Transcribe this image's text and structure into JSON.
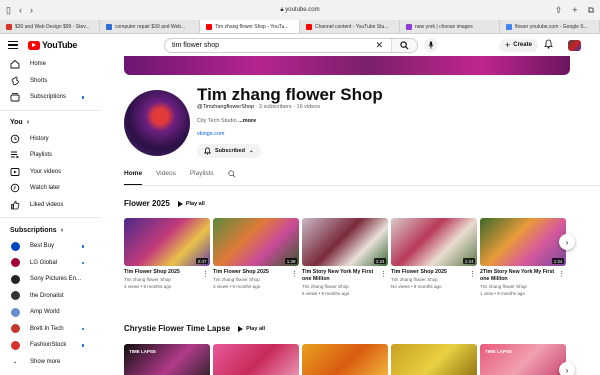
{
  "browser": {
    "url": "youtube.com",
    "tabs": [
      {
        "label": "$30 and Web Design $99 - Stev...",
        "color": "#d8342c"
      },
      {
        "label": "computer repair $30 and Web...",
        "color": "#2d6fd6"
      },
      {
        "label": "Tim zhang flower Shop - YouTu...",
        "color": "#ff0000",
        "active": true
      },
      {
        "label": "Channel content - YouTube Stu...",
        "color": "#ff0000"
      },
      {
        "label": "new york | choose images",
        "color": "#8a3fd6"
      },
      {
        "label": "flower youtube.com - Google S...",
        "color": "#4285f4"
      }
    ]
  },
  "header": {
    "logo_text": "YouTube",
    "search_query": "tim flower shop",
    "create_label": "Create"
  },
  "sidebar": {
    "main": [
      {
        "label": "Home",
        "icon": "home-icon"
      },
      {
        "label": "Shorts",
        "icon": "shorts-icon"
      },
      {
        "label": "Subscriptions",
        "icon": "subscriptions-icon",
        "dot": true
      }
    ],
    "you_heading": "You",
    "you_items": [
      {
        "label": "History",
        "icon": "history-icon"
      },
      {
        "label": "Playlists",
        "icon": "playlists-icon"
      },
      {
        "label": "Your videos",
        "icon": "your-videos-icon"
      },
      {
        "label": "Watch later",
        "icon": "watch-later-icon"
      },
      {
        "label": "Liked videos",
        "icon": "liked-videos-icon"
      }
    ],
    "subs_heading": "Subscriptions",
    "subscriptions": [
      {
        "label": "Best Buy",
        "color": "#0046be"
      },
      {
        "label": "LG Global",
        "color": "#a50034"
      },
      {
        "label": "Sony Pictures En...",
        "color": "#222222"
      },
      {
        "label": "the Dronalist",
        "color": "#333333"
      },
      {
        "label": "Amp World",
        "color": "#6a8fd0"
      },
      {
        "label": "Brett In Tech",
        "color": "#c0392b"
      },
      {
        "label": "FashionStock",
        "color": "#d63031"
      },
      {
        "label": "Show more",
        "color": "#888888"
      }
    ]
  },
  "channel": {
    "name": "Tim zhang flower Shop",
    "handle": "@TimzhangflowerShop",
    "stats": " · 3 subscribers · 16 videos",
    "desc": "City Tech Studio ",
    "more": "...more",
    "link": "vkings.com",
    "subscribe_label": "Subscribed",
    "tabs": [
      "Home",
      "Videos",
      "Playlists"
    ]
  },
  "section1": {
    "title": "Flower 2025",
    "play_all": "Play all",
    "videos": [
      {
        "title": "Tim Flower Shop 2025",
        "channel": "Tim zhang flower Shop",
        "meta": "4 views • 9 months ago",
        "duration": "2:47",
        "bg": "linear-gradient(135deg,#4b2a8a,#c33b7a 45%,#e8c24a 70%,#6a3fa0)"
      },
      {
        "title": "Tim Flower Shop 2025",
        "channel": "Tim zhang flower Shop",
        "meta": "3 views • 9 months ago",
        "duration": "1:39",
        "bg": "linear-gradient(135deg,#5a8a3a,#e07a3a 40%,#c84a9a 65%,#3a5a2a)"
      },
      {
        "title": "Tim Story New York My First one Million",
        "channel": "Tim zhang flower Shop",
        "meta": "5 views • 9 months ago",
        "duration": "1:24",
        "bg": "linear-gradient(135deg,#c9b8c8,#7a2a3a 45%,#e8e0d8 70%,#3a6a3a)"
      },
      {
        "title": "Tim Flower Shop 2025",
        "channel": "Tim zhang flower Shop",
        "meta": "No views • 9 months ago",
        "duration": "1:24",
        "bg": "linear-gradient(135deg,#d8c8c8,#b83a5a 40%,#eadcd0 65%,#5a7a4a)"
      },
      {
        "title": "2Tim Story New York My First one Million",
        "channel": "Tim zhang flower Shop",
        "meta": "1 view • 9 months ago",
        "duration": "1:24",
        "bg": "linear-gradient(135deg,#3a6a2a,#e89a3a 40%,#d85a9a 65%,#7a4aa0)"
      }
    ]
  },
  "section2": {
    "title": "Chrystie Flower Time Lapse",
    "play_all": "Play all",
    "videos": [
      {
        "label": "TIME LAPSE",
        "bg": "linear-gradient(135deg,#111,#b03a8a 55%,#222)"
      },
      {
        "label": "",
        "bg": "linear-gradient(135deg,#e85a9a,#c82a5a 50%,#f0a0c0)"
      },
      {
        "label": "",
        "bg": "linear-gradient(135deg,#e8a020,#d85a10 50%,#f5c040)"
      },
      {
        "label": "",
        "bg": "linear-gradient(135deg,#c8a020,#e8d040 50%,#8a6a10)"
      },
      {
        "label": "TIME LAPSE",
        "bg": "linear-gradient(135deg,#e85a7a,#f0a0b0 50%,#c83a6a)"
      }
    ]
  }
}
